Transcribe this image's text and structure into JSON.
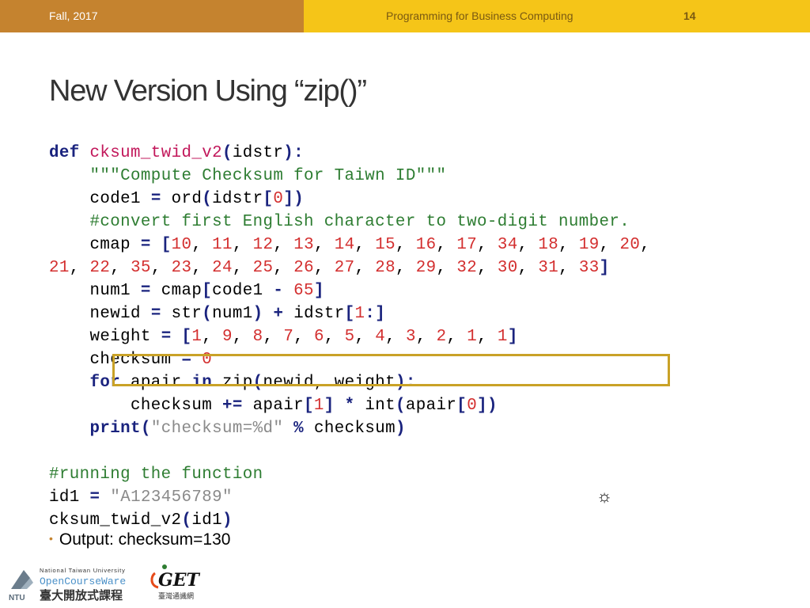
{
  "header": {
    "date": "Fall, 2017",
    "course": "Programming for Business Computing",
    "page_number": "14",
    "colors": {
      "left": "#C5832F",
      "right": "#F5C518"
    }
  },
  "slide": {
    "title": "New Version Using “zip()”",
    "code_lines": [
      "def cksum_twid_v2(idstr):",
      "    \"\"\"Compute Checksum for Taiwn ID\"\"\"",
      "    code1 = ord(idstr[0])",
      "    #convert first English character to two-digit number.",
      "    cmap = [10, 11, 12, 13, 14, 15, 16, 17, 34, 18, 19, 20,",
      "21, 22, 35, 23, 24, 25, 26, 27, 28, 29, 32, 30, 31, 33]",
      "    num1 = cmap[code1 - 65]",
      "    newid = str(num1) + idstr[1:]",
      "    weight = [1, 9, 8, 7, 6, 5, 4, 3, 2, 1, 1]",
      "    checksum = 0",
      "    for apair in zip(newid, weight):",
      "        checksum += apair[1] * int(apair[0])",
      "    print(\"checksum=%d\" % checksum)",
      "",
      "#running the function",
      "id1 = \"A123456789\"",
      "cksum_twid_v2(id1)"
    ],
    "output_bullet": "Output: checksum=130",
    "highlight_color": "#c9a227"
  },
  "logos": {
    "ocw_university": "National Taiwan University",
    "ocw_name": "OpenCourseWare",
    "ocw_chinese": "臺大開放式課程",
    "ocw_mark": "NTU",
    "get_mark": "GET",
    "get_chinese": "臺灣通識網"
  },
  "icons": [
    "sun-symbol-icon"
  ]
}
